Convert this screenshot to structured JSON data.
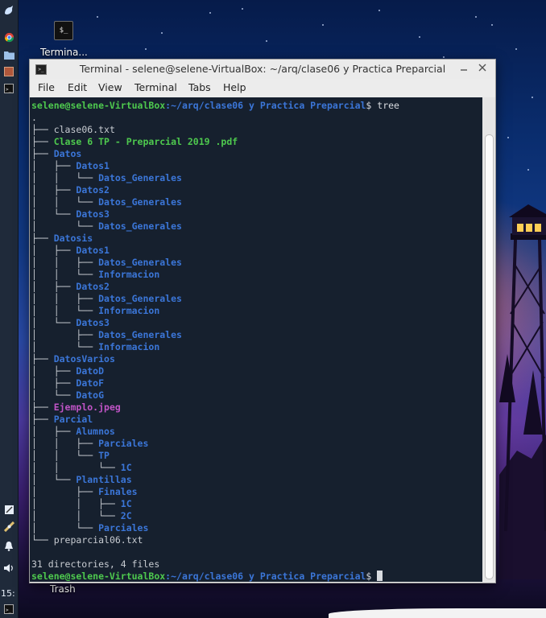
{
  "desktop": {
    "terminal_icon_label": "Termina...",
    "trash_label": "Trash",
    "clock": "15:"
  },
  "window": {
    "title": "Terminal - selene@selene-VirtualBox: ~/arq/clase06 y Practica Preparcial",
    "menu": [
      "File",
      "Edit",
      "View",
      "Terminal",
      "Tabs",
      "Help"
    ]
  },
  "terminal": {
    "prompt_user": "selene@selene-VirtualBox",
    "prompt_path": ":~/arq/clase06 y Practica Preparcial",
    "prompt_symbol": "$ ",
    "command": "tree",
    "root": ".",
    "tree": [
      {
        "prefix": "├── ",
        "name": "clase06.txt",
        "kind": "file"
      },
      {
        "prefix": "├── ",
        "name": "Clase 6 TP - Preparcial 2019 .pdf",
        "kind": "exec"
      },
      {
        "prefix": "├── ",
        "name": "Datos",
        "kind": "dir"
      },
      {
        "prefix": "│   ├── ",
        "name": "Datos1",
        "kind": "dir"
      },
      {
        "prefix": "│   │   └── ",
        "name": "Datos_Generales",
        "kind": "dir"
      },
      {
        "prefix": "│   ├── ",
        "name": "Datos2",
        "kind": "dir"
      },
      {
        "prefix": "│   │   └── ",
        "name": "Datos_Generales",
        "kind": "dir"
      },
      {
        "prefix": "│   └── ",
        "name": "Datos3",
        "kind": "dir"
      },
      {
        "prefix": "│       └── ",
        "name": "Datos_Generales",
        "kind": "dir"
      },
      {
        "prefix": "├── ",
        "name": "Datosis",
        "kind": "dir"
      },
      {
        "prefix": "│   ├── ",
        "name": "Datos1",
        "kind": "dir"
      },
      {
        "prefix": "│   │   ├── ",
        "name": "Datos_Generales",
        "kind": "dir"
      },
      {
        "prefix": "│   │   └── ",
        "name": "Informacion",
        "kind": "dir"
      },
      {
        "prefix": "│   ├── ",
        "name": "Datos2",
        "kind": "dir"
      },
      {
        "prefix": "│   │   ├── ",
        "name": "Datos_Generales",
        "kind": "dir"
      },
      {
        "prefix": "│   │   └── ",
        "name": "Informacion",
        "kind": "dir"
      },
      {
        "prefix": "│   └── ",
        "name": "Datos3",
        "kind": "dir"
      },
      {
        "prefix": "│       ├── ",
        "name": "Datos_Generales",
        "kind": "dir"
      },
      {
        "prefix": "│       └── ",
        "name": "Informacion",
        "kind": "dir"
      },
      {
        "prefix": "├── ",
        "name": "DatosVarios",
        "kind": "dir"
      },
      {
        "prefix": "│   ├── ",
        "name": "DatoD",
        "kind": "dir"
      },
      {
        "prefix": "│   ├── ",
        "name": "DatoF",
        "kind": "dir"
      },
      {
        "prefix": "│   └── ",
        "name": "DatoG",
        "kind": "dir"
      },
      {
        "prefix": "├── ",
        "name": "Ejemplo.jpeg",
        "kind": "img"
      },
      {
        "prefix": "├── ",
        "name": "Parcial",
        "kind": "dir"
      },
      {
        "prefix": "│   ├── ",
        "name": "Alumnos",
        "kind": "dir"
      },
      {
        "prefix": "│   │   ├── ",
        "name": "Parciales",
        "kind": "dir"
      },
      {
        "prefix": "│   │   └── ",
        "name": "TP",
        "kind": "dir"
      },
      {
        "prefix": "│   │       └── ",
        "name": "1C",
        "kind": "dir"
      },
      {
        "prefix": "│   └── ",
        "name": "Plantillas",
        "kind": "dir"
      },
      {
        "prefix": "│       ├── ",
        "name": "Finales",
        "kind": "dir"
      },
      {
        "prefix": "│       │   ├── ",
        "name": "1C",
        "kind": "dir"
      },
      {
        "prefix": "│       │   └── ",
        "name": "2C",
        "kind": "dir"
      },
      {
        "prefix": "│       └── ",
        "name": "Parciales",
        "kind": "dir"
      },
      {
        "prefix": "└── ",
        "name": "preparcial06.txt",
        "kind": "file"
      }
    ],
    "summary": "31 directories, 4 files"
  },
  "colors": {
    "terminal_bg": "#16202e",
    "dir": "#3b76d8",
    "exec": "#4ec94e",
    "image": "#c054c6",
    "text": "#c8ccd2"
  }
}
